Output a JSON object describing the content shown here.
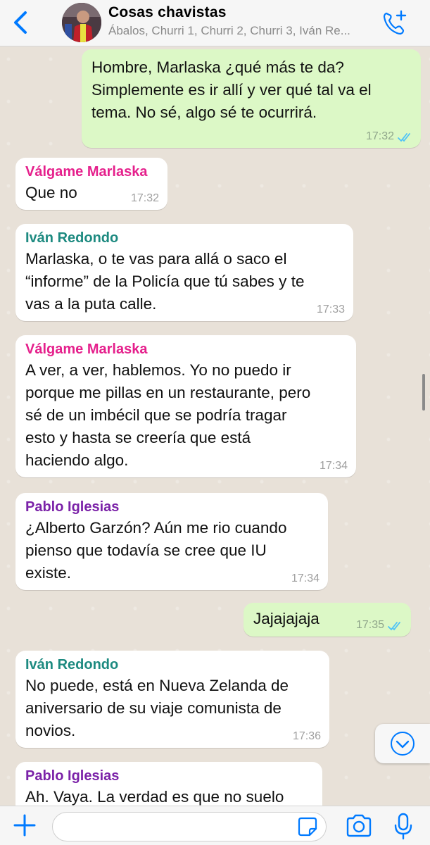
{
  "header": {
    "title": "Cosas chavistas",
    "subtitle": "Ábalos, Churri 1, Churri 2, Churri 3, Iván Re..."
  },
  "colors": {
    "accent": "#007aff",
    "outgoing_bubble": "#dcf8c6",
    "incoming_bubble": "#ffffff",
    "read_ticks": "#4fc3f7",
    "sender_valgame": "#e5208c",
    "sender_ivan": "#1d8a80",
    "sender_pablo": "#7b22a8"
  },
  "messages": [
    {
      "type": "out",
      "text": "Hombre, Marlaska ¿qué más te da?\nSimplemente es ir allí y ver qué tal va el\ntema. No sé, algo sé te ocurrirá.",
      "time": "17:32"
    },
    {
      "type": "in",
      "sender": "Válgame Marlaska",
      "text": "Que no",
      "time": "17:32"
    },
    {
      "type": "in",
      "sender": "Iván Redondo",
      "text": "Marlaska, o te vas para allá o saco el\n“informe” de la Policía que tú sabes y te\nvas a la puta calle.",
      "time": "17:33"
    },
    {
      "type": "in",
      "sender": "Válgame Marlaska",
      "text": "A ver, a ver, hablemos. Yo no puedo ir\nporque me pillas en un restaurante, pero\nsé de un imbécil que se podría tragar\nesto y hasta se creería que está\nhaciendo algo.",
      "time": "17:34"
    },
    {
      "type": "in",
      "sender": "Pablo Iglesias",
      "text": "¿Alberto Garzón? Aún me rio cuando\npienso que todavía se cree que IU\nexiste.",
      "time": "17:34"
    },
    {
      "type": "out",
      "text": "Jajajajaja",
      "time": "17:35"
    },
    {
      "type": "in",
      "sender": "Iván Redondo",
      "text": "No puede, está en Nueva Zelanda de\naniversario de su viaje comunista de\nnovios.",
      "time": "17:36"
    },
    {
      "type": "in",
      "sender": "Pablo Iglesias",
      "text": "Ah. Vaya. La verdad es que no suelo",
      "time": ""
    }
  ],
  "composer": {
    "value": "",
    "placeholder": ""
  },
  "icons": {
    "back": "chevron-left-icon",
    "call": "add-call-icon",
    "plus": "plus-icon",
    "sticker": "sticker-icon",
    "camera": "camera-icon",
    "mic": "microphone-icon",
    "scroll_down": "chevron-down-icon",
    "ticks": "double-check-icon"
  }
}
